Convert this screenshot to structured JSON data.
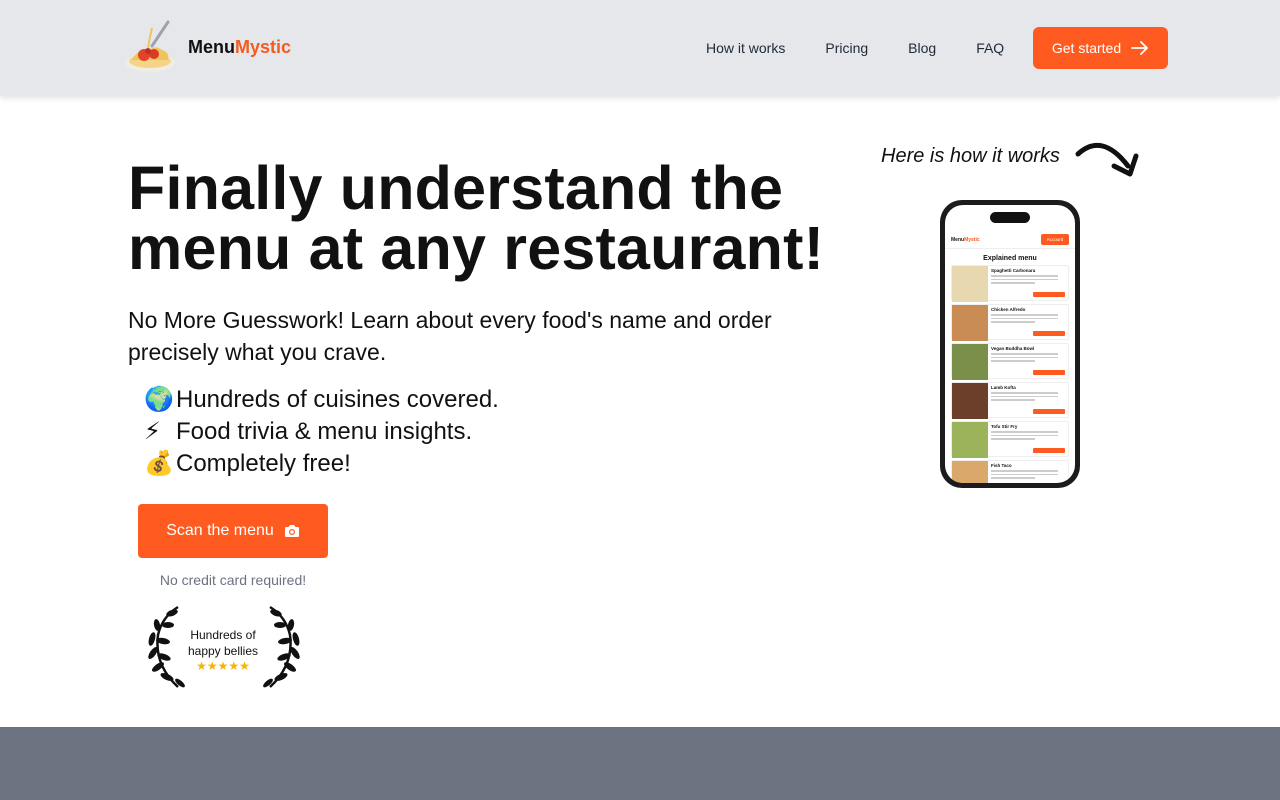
{
  "header": {
    "brand_part1": "Menu",
    "brand_part2": "Mystic",
    "logo_icon": "spaghetti-icon",
    "nav": [
      "How it works",
      "Pricing",
      "Blog",
      "FAQ"
    ],
    "cta_label": "Get started",
    "cta_icon": "arrow-right-icon"
  },
  "hero": {
    "title": "Finally understand the menu at any restaurant!",
    "subtitle": "No More Guesswork! Learn about every food's name and order precisely what you crave.",
    "features": [
      {
        "emoji": "🌍",
        "text": "Hundreds of cuisines covered."
      },
      {
        "emoji": "⚡",
        "text": "Food trivia & menu insights."
      },
      {
        "emoji": "💰",
        "text": "Completely free!"
      }
    ],
    "scan_label": "Scan the menu",
    "scan_icon": "camera-icon",
    "no_cc": "No credit card required!",
    "badge_line1": "Hundreds of",
    "badge_line2": "happy bellies",
    "rating_stars": 5
  },
  "demo": {
    "label": "Here is how it works",
    "phone": {
      "brand_part1": "Menu",
      "brand_part2": "Mystic",
      "account_label": "Account",
      "heading": "Explained menu",
      "items": [
        "Spaghetti Carbonara",
        "Chicken Alfredo",
        "Vegan Buddha Bowl",
        "Lamb Kofta",
        "Tofu Stir Fry",
        "Fish Taco"
      ]
    }
  },
  "colors": {
    "accent": "#ff5a1f",
    "header_bg": "#e5e7eb",
    "footer_bg": "#6b7280"
  }
}
